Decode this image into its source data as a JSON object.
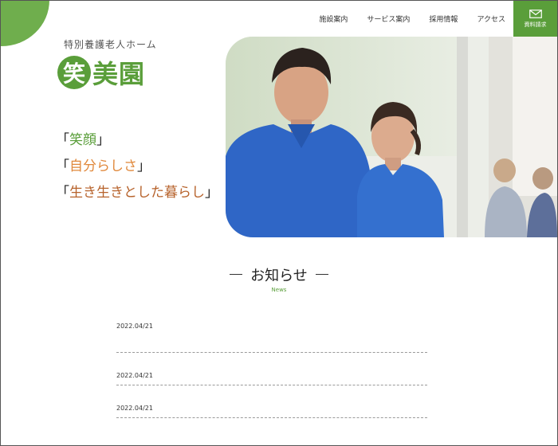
{
  "brand": {
    "subtitle": "特別養護老人ホーム",
    "logo_mark": "笑",
    "logo_rest": "美園"
  },
  "nav": {
    "items": [
      {
        "label": "施設案内"
      },
      {
        "label": "サービス案内"
      },
      {
        "label": "採用情報"
      },
      {
        "label": "アクセス"
      }
    ],
    "doc_request_label": "資料請求",
    "doc_request_icon": "mail-icon"
  },
  "hero": {
    "photo": "two-caregivers-in-blue-polo-shirts"
  },
  "tagline": {
    "line1": "笑顔",
    "line2": "自分らしさ",
    "line3": "生き生きとした暮らし",
    "open_quote": "「",
    "close_quote": "」"
  },
  "news": {
    "title": "お知らせ",
    "subtitle": "News",
    "items": [
      {
        "date": "2022.04/21"
      },
      {
        "date": "2022.04/21"
      },
      {
        "date": "2022.04/21"
      }
    ]
  },
  "colors": {
    "accent_green": "#5a9e3a",
    "accent_orange": "#e0883b",
    "accent_brown": "#b7632c"
  }
}
